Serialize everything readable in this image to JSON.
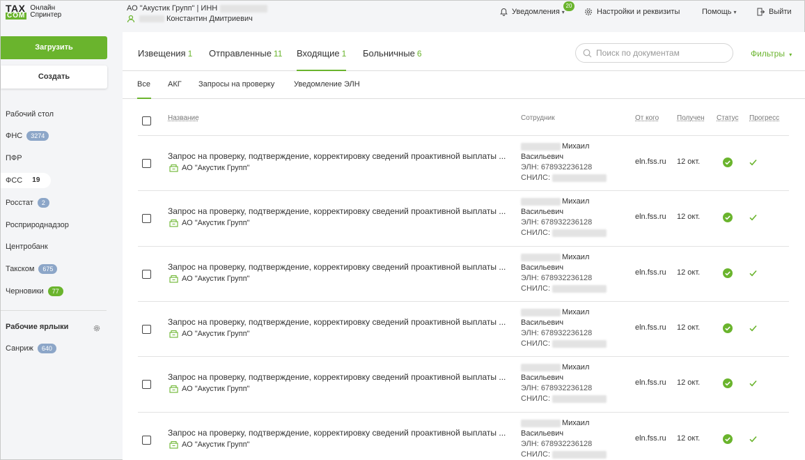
{
  "app": {
    "logo_tax": "TAX",
    "logo_com": "COM",
    "product_line1": "Онлайн",
    "product_line2": "Спринтер"
  },
  "header": {
    "org_label": "АО \"Акустик Групп\" | ИНН",
    "user_name": "Константин Дмитриевич",
    "notifications_label": "Уведомления",
    "notifications_count": "20",
    "settings_label": "Настройки и реквизиты",
    "help_label": "Помощь",
    "logout_label": "Выйти"
  },
  "sidebar": {
    "upload_label": "Загрузить",
    "create_label": "Создать",
    "items": [
      {
        "label": "Рабочий стол",
        "count": ""
      },
      {
        "label": "ФНС",
        "count": "3274"
      },
      {
        "label": "ПФР",
        "count": ""
      },
      {
        "label": "ФСС",
        "count": "19"
      },
      {
        "label": "Росстат",
        "count": "2"
      },
      {
        "label": "Росприроднадзор",
        "count": ""
      },
      {
        "label": "Центробанк",
        "count": ""
      },
      {
        "label": "Такском",
        "count": "675"
      },
      {
        "label": "Черновики",
        "count": "77"
      }
    ],
    "labels_title": "Рабочие ярлыки",
    "labels": [
      {
        "label": "Санриж",
        "count": "640"
      }
    ]
  },
  "tabs": [
    {
      "label": "Извещения",
      "count": "1"
    },
    {
      "label": "Отправленные",
      "count": "11"
    },
    {
      "label": "Входящие",
      "count": "1"
    },
    {
      "label": "Больничные",
      "count": "6"
    }
  ],
  "search": {
    "placeholder": "Поиск по документам"
  },
  "filters_label": "Фильтры",
  "subtabs": [
    "Все",
    "АКГ",
    "Запросы на проверку",
    "Уведомление ЭЛН"
  ],
  "table": {
    "headers": {
      "name": "Название",
      "employee": "Сотрудник",
      "from": "От кого",
      "received": "Получен",
      "status": "Статус",
      "progress": "Прогресс"
    },
    "rows": [
      {
        "title": "Запрос на проверку, подтверждение, корректировку сведений проактивной выплаты ...",
        "org": "АО \"Акустик Групп\"",
        "first_name": "Михаил",
        "patronymic": "Васильевич",
        "eln": "ЭЛН: 678932236128",
        "snils_label": "СНИЛС:",
        "from": "eln.fss.ru",
        "received": "12 окт."
      },
      {
        "title": "Запрос на проверку, подтверждение, корректировку сведений проактивной выплаты ...",
        "org": "АО \"Акустик Групп\"",
        "first_name": "Михаил",
        "patronymic": "Васильевич",
        "eln": "ЭЛН: 678932236128",
        "snils_label": "СНИЛС:",
        "from": "eln.fss.ru",
        "received": "12 окт."
      },
      {
        "title": "Запрос на проверку, подтверждение, корректировку сведений проактивной выплаты ...",
        "org": "АО \"Акустик Групп\"",
        "first_name": "Михаил",
        "patronymic": "Васильевич",
        "eln": "ЭЛН: 678932236128",
        "snils_label": "СНИЛС:",
        "from": "eln.fss.ru",
        "received": "12 окт."
      },
      {
        "title": "Запрос на проверку, подтверждение, корректировку сведений проактивной выплаты ...",
        "org": "АО \"Акустик Групп\"",
        "first_name": "Михаил",
        "patronymic": "Васильевич",
        "eln": "ЭЛН: 678932236128",
        "snils_label": "СНИЛС:",
        "from": "eln.fss.ru",
        "received": "12 окт."
      },
      {
        "title": "Запрос на проверку, подтверждение, корректировку сведений проактивной выплаты ...",
        "org": "АО \"Акустик Групп\"",
        "first_name": "Михаил",
        "patronymic": "Васильевич",
        "eln": "ЭЛН: 678932236128",
        "snils_label": "СНИЛС:",
        "from": "eln.fss.ru",
        "received": "12 окт."
      },
      {
        "title": "Запрос на проверку, подтверждение, корректировку сведений проактивной выплаты ...",
        "org": "АО \"Акустик Групп\"",
        "first_name": "Михаил",
        "patronymic": "Васильевич",
        "eln": "ЭЛН: 678932236128",
        "snils_label": "СНИЛС:",
        "from": "eln.fss.ru",
        "received": "12 окт."
      }
    ]
  },
  "colors": {
    "accent": "#6ab42d",
    "badge_blue": "#8ca6c8"
  }
}
